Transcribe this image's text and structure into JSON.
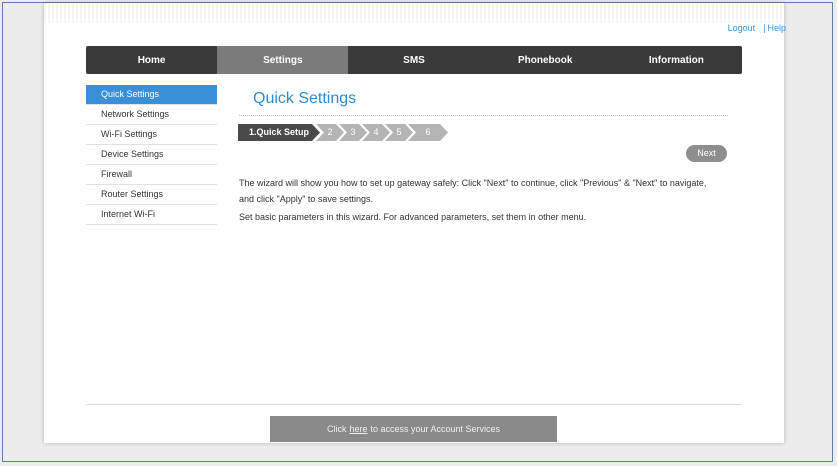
{
  "header": {
    "logout_label": "Logout",
    "help_label": "Help",
    "separator": "|"
  },
  "nav": {
    "items": [
      {
        "label": "Home"
      },
      {
        "label": "Settings"
      },
      {
        "label": "SMS"
      },
      {
        "label": "Phonebook"
      },
      {
        "label": "Information"
      }
    ],
    "active": "Settings"
  },
  "sidebar": {
    "items": [
      {
        "label": "Quick Settings"
      },
      {
        "label": "Network Settings"
      },
      {
        "label": "Wi-Fi Settings"
      },
      {
        "label": "Device Settings"
      },
      {
        "label": "Firewall"
      },
      {
        "label": "Router Settings"
      },
      {
        "label": "Internet Wi-Fi"
      }
    ],
    "active": "Quick Settings"
  },
  "main": {
    "title": "Quick Settings",
    "steps": [
      {
        "label": "1.Quick Setup"
      },
      {
        "label": "2"
      },
      {
        "label": "3"
      },
      {
        "label": "4"
      },
      {
        "label": "5"
      },
      {
        "label": "6"
      }
    ],
    "next_label": "Next",
    "description_1": "The wizard will show you how to set up gateway safely: Click \"Next\" to continue, click \"Previous\" & \"Next\" to navigate, and click \"Apply\" to save settings.",
    "description_2": "Set basic parameters in this wizard. For advanced parameters, set them in other menu."
  },
  "footer": {
    "prefix": "Click",
    "link_label": "here",
    "suffix": "to access your Account Services"
  },
  "colors": {
    "accent": "#2e8bd0",
    "nav_bg": "#3a3a3a",
    "nav_active": "#7b7b7b",
    "sidebar_active": "#3a8fd9"
  }
}
